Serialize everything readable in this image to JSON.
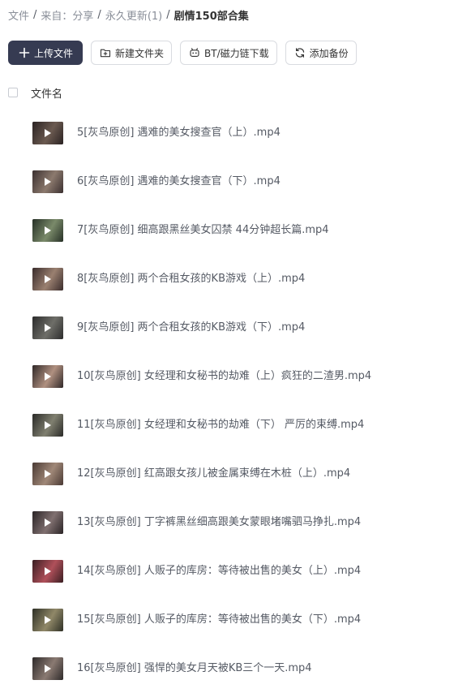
{
  "breadcrumb": [
    {
      "label": "文件",
      "current": false
    },
    {
      "label": "来自：分享",
      "current": false
    },
    {
      "label": "永久更新(1)",
      "current": false
    },
    {
      "label": "剧情150部合集",
      "current": true
    }
  ],
  "toolbar": {
    "upload_label": "上传文件",
    "new_folder_label": "新建文件夹",
    "bt_download_label": "BT/磁力链下载",
    "add_backup_label": "添加备份"
  },
  "list_header": {
    "filename_label": "文件名"
  },
  "files": [
    {
      "name": "5[灰鸟原创] 遇难的美女搜查官（上）.mp4",
      "thumb": "video-thumbnail"
    },
    {
      "name": "6[灰鸟原创] 遇难的美女搜查官（下）.mp4",
      "thumb": "video-thumbnail"
    },
    {
      "name": "7[灰鸟原创] 细高跟黑丝美女囚禁 44分钟超长篇.mp4",
      "thumb": "video-thumbnail"
    },
    {
      "name": "8[灰鸟原创] 两个合租女孩的KB游戏（上）.mp4",
      "thumb": "video-thumbnail"
    },
    {
      "name": "9[灰鸟原创] 两个合租女孩的KB游戏（下）.mp4",
      "thumb": "video-thumbnail"
    },
    {
      "name": "10[灰鸟原创] 女经理和女秘书的劫难（上）疯狂的二渣男.mp4",
      "thumb": "video-thumbnail"
    },
    {
      "name": "11[灰鸟原创] 女经理和女秘书的劫难（下） 严厉的束缚.mp4",
      "thumb": "video-thumbnail"
    },
    {
      "name": "12[灰鸟原创] 红高跟女孩儿被金属束缚在木桩（上）.mp4",
      "thumb": "video-thumbnail"
    },
    {
      "name": "13[灰鸟原创] 丁字裤黑丝细高跟美女蒙眼堵嘴驷马挣扎.mp4",
      "thumb": "video-thumbnail"
    },
    {
      "name": "14[灰鸟原创] 人贩子的库房：等待被出售的美女（上）.mp4",
      "thumb": "video-thumbnail"
    },
    {
      "name": "15[灰鸟原创] 人贩子的库房：等待被出售的美女（下）.mp4",
      "thumb": "video-thumbnail"
    },
    {
      "name": "16[灰鸟原创] 强悍的美女月天被KB三个一天.mp4",
      "thumb": "video-thumbnail"
    }
  ],
  "colors": {
    "primary_button": "#363b52",
    "text": "#333333",
    "muted_text": "#8a8f99",
    "file_text": "#555a64"
  }
}
